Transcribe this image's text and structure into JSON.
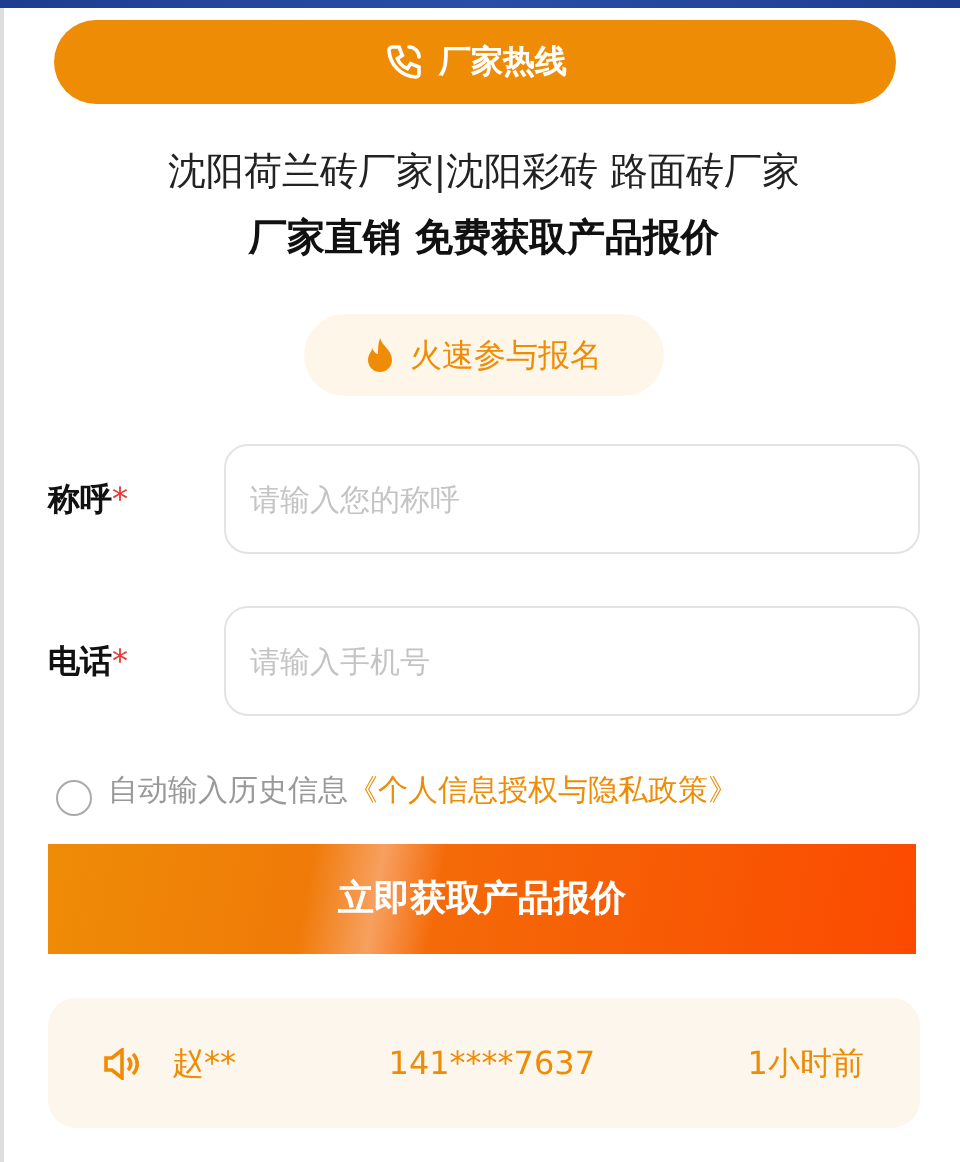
{
  "hotline_button": {
    "label": "厂家热线"
  },
  "headline": [
    "沈阳荷兰砖厂家|沈阳彩砖 路面砖厂家",
    "厂家直销 免费获取产品报价"
  ],
  "signup_pill": {
    "label": "火速参与报名"
  },
  "fields": [
    {
      "label": "称呼",
      "required_mark": "*",
      "placeholder": "请输入您的称呼"
    },
    {
      "label": "电话",
      "required_mark": "*",
      "placeholder": "请输入手机号"
    }
  ],
  "consent": {
    "checked": false,
    "text": "自动输入历史信息",
    "link": "《个人信息授权与隐私政策》"
  },
  "submit_button": {
    "label": "立即获取产品报价"
  },
  "notice": {
    "name": "赵**",
    "phone": "141****7637",
    "time": "1小时前"
  }
}
